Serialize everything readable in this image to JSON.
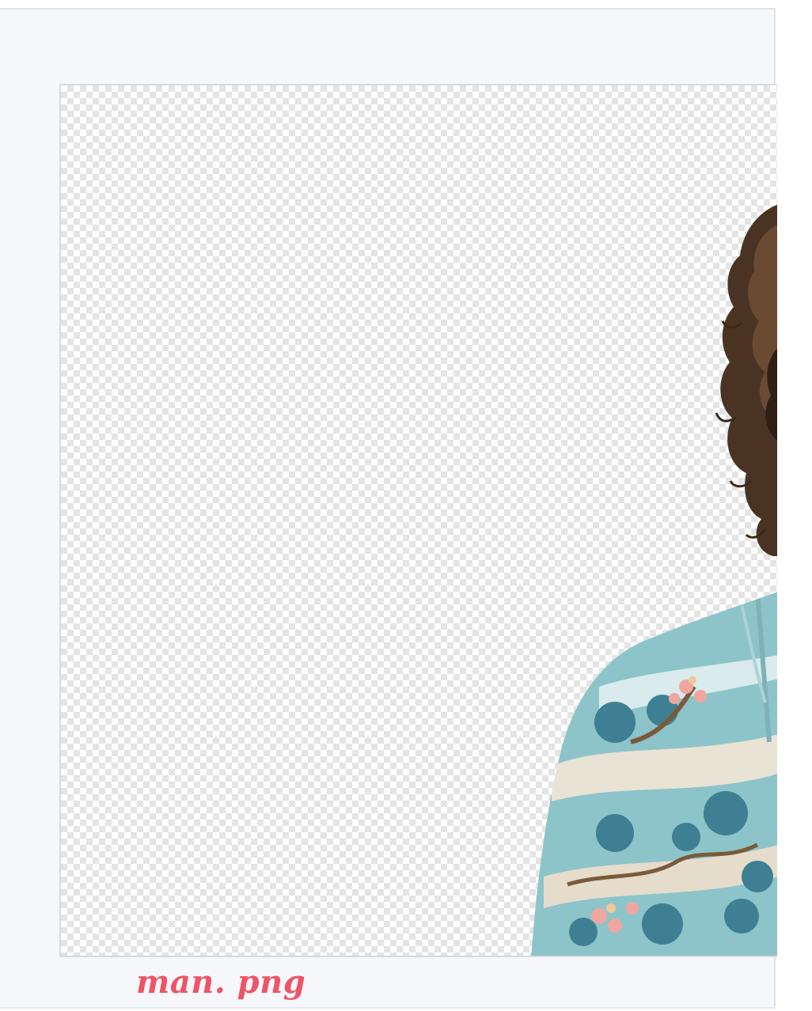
{
  "preview": {
    "background": "transparency-checkerboard",
    "subject": "person-cutout"
  },
  "file": {
    "name": "man. png"
  },
  "colors": {
    "panel_bg": "#f5f7fa",
    "frame_border": "#d3dbe3",
    "label": "#ef5466"
  }
}
